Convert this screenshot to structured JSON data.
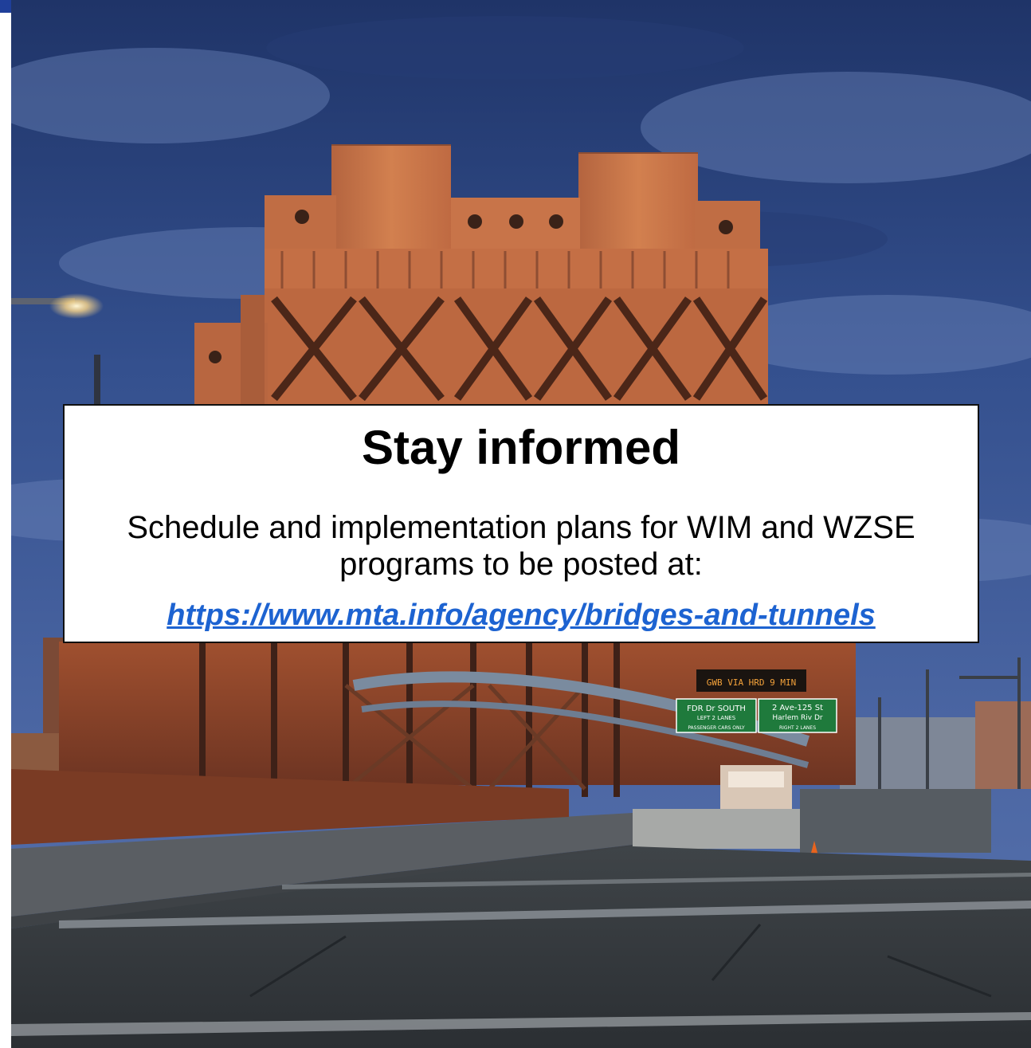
{
  "colors": {
    "accent": "#1f3f9a",
    "link": "#1d63d1",
    "panel_background": "#ffffff",
    "panel_border": "#111111"
  },
  "photo": {
    "signs": {
      "dms": "GWB VIA HRD 9 MIN",
      "left_sign_line1": "FDR Dr SOUTH",
      "left_sign_line2": "LEFT 2 LANES",
      "left_sign_line3": "PASSENGER CARS ONLY",
      "right_sign_line1": "2 Ave-125 St",
      "right_sign_line2": "Harlem Riv Dr",
      "right_sign_line3": "RIGHT 2 LANES"
    }
  },
  "info_box": {
    "title": "Stay informed",
    "body": "Schedule and implementation plans for WIM and WZSE programs to be posted at:",
    "link_text": "https://www.mta.info/agency/bridges-and-tunnels",
    "link_href": "https://www.mta.info/agency/bridges-and-tunnels"
  }
}
